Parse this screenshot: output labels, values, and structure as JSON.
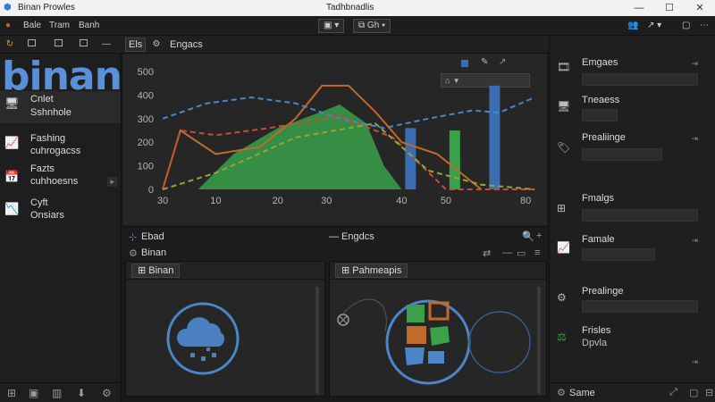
{
  "window": {
    "title": "Binan Prowles",
    "center_title": "Tadhbnadlis"
  },
  "menu": {
    "items": [
      "Bale",
      "Tram",
      "Banh"
    ],
    "btn1": "▣ ▾",
    "btn2": "⧉ Gh ▾"
  },
  "toolbar": {
    "tab_label": "Els",
    "title": "Engacs"
  },
  "sidebar": {
    "logo": "binan",
    "items": [
      {
        "title": "Cnlet",
        "sub": "Sshnhole",
        "icon": "monitor-icon"
      },
      {
        "title": "Fashing",
        "sub": "cuhrogacss",
        "icon": "chart-up-icon"
      },
      {
        "title": "Fazts",
        "sub": "cuhhoesns",
        "icon": "calendar-icon"
      },
      {
        "title": "Cyft",
        "sub": "Onsiars",
        "icon": "chart-down-icon"
      }
    ]
  },
  "chart_data": {
    "type": "line",
    "x_tick_labels": [
      "30",
      "10",
      "20",
      "30",
      "40",
      "50",
      "80"
    ],
    "y_tick_labels": [
      "500",
      "400",
      "300",
      "200",
      "100",
      "0"
    ],
    "ylim": [
      0,
      500
    ],
    "series": [
      {
        "color": "#4a86c8",
        "style": "dashed",
        "points": [
          [
            0,
            300
          ],
          [
            50,
            365
          ],
          [
            100,
            390
          ],
          [
            150,
            365
          ],
          [
            200,
            300
          ],
          [
            250,
            260
          ],
          [
            300,
            300
          ],
          [
            350,
            335
          ],
          [
            380,
            325
          ],
          [
            420,
            390
          ]
        ]
      },
      {
        "color": "#c26a2b",
        "style": "solid",
        "points": [
          [
            0,
            0
          ],
          [
            20,
            250
          ],
          [
            60,
            150
          ],
          [
            110,
            180
          ],
          [
            150,
            300
          ],
          [
            180,
            440
          ],
          [
            210,
            440
          ],
          [
            240,
            330
          ],
          [
            270,
            200
          ],
          [
            310,
            150
          ],
          [
            360,
            0
          ]
        ]
      },
      {
        "color": "#c94b3a",
        "style": "dashed",
        "points": [
          [
            0,
            0
          ],
          [
            20,
            250
          ],
          [
            60,
            230
          ],
          [
            120,
            260
          ],
          [
            200,
            310
          ],
          [
            260,
            220
          ],
          [
            320,
            0
          ],
          [
            420,
            0
          ]
        ]
      },
      {
        "color": "#9aa23a",
        "style": "dashed",
        "points": [
          [
            0,
            0
          ],
          [
            60,
            70
          ],
          [
            150,
            220
          ],
          [
            240,
            280
          ],
          [
            300,
            80
          ],
          [
            360,
            20
          ],
          [
            420,
            0
          ]
        ]
      }
    ],
    "area": {
      "color": "#3aa04a",
      "points": [
        [
          40,
          0
        ],
        [
          80,
          150
        ],
        [
          130,
          260
        ],
        [
          180,
          330
        ],
        [
          200,
          360
        ],
        [
          230,
          280
        ],
        [
          250,
          100
        ],
        [
          270,
          0
        ]
      ]
    },
    "bars": [
      {
        "x": 280,
        "value": 260,
        "color": "#3b6db0"
      },
      {
        "x": 330,
        "value": 250,
        "color": "#3aa04a"
      },
      {
        "x": 375,
        "value": 440,
        "color": "#3b6db0"
      }
    ]
  },
  "midstrip": {
    "left_label": "Ebad",
    "center_label": "Engdcs",
    "sub_label": "Binan"
  },
  "panels": {
    "left": {
      "title": "Binan"
    },
    "right": {
      "title": "Pahmeapis"
    }
  },
  "right_sidebar": {
    "items": [
      {
        "title": "Emgaes",
        "icon": "projector-icon"
      },
      {
        "title": "Tneaess",
        "icon": "monitor-icon"
      },
      {
        "title": "Prealiinge",
        "icon": "tag-icon"
      },
      {
        "title": "Fmalgs",
        "icon": "grid-icon"
      },
      {
        "title": "Famale",
        "icon": "chart-line-icon"
      },
      {
        "title": "Prealinge",
        "icon": "chip-icon"
      },
      {
        "title": "Frisles",
        "sub": "Dpvla",
        "icon": "scale-icon"
      }
    ],
    "footer": "Same"
  }
}
